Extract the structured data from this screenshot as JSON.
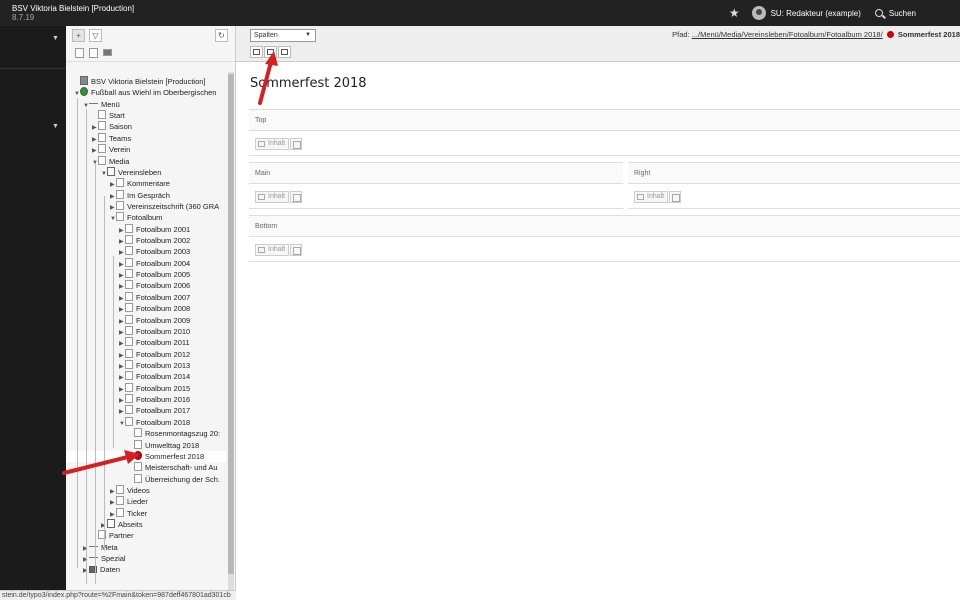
{
  "topbar": {
    "site_name": "BSV Viktoria Bielstein [Production]",
    "version": "8.7.19",
    "user_label": "SU: Redakteur (example)",
    "search_label": "Suchen"
  },
  "tree": {
    "nodes": [
      {
        "label": "BSV Viktoria Bielstein [Production]",
        "icon": "typo3-logo-icon"
      },
      {
        "label": "Fußball aus Wiehl im Oberbergischen",
        "icon": "globe-icon"
      },
      {
        "label": "Menü",
        "icon": "menu-separator-icon"
      },
      {
        "label": "Start",
        "icon": "page-icon"
      },
      {
        "label": "Saison",
        "icon": "page-icon"
      },
      {
        "label": "Teams",
        "icon": "page-icon"
      },
      {
        "label": "Verein",
        "icon": "page-icon"
      },
      {
        "label": "Media",
        "icon": "page-icon"
      },
      {
        "label": "Vereinsleben",
        "icon": "shortcut-page-icon"
      },
      {
        "label": "Kommentare",
        "icon": "page-icon"
      },
      {
        "label": "Im Gespräch",
        "icon": "page-icon"
      },
      {
        "label": "Vereinszeitschrift (360 GRA",
        "icon": "page-icon"
      },
      {
        "label": "Fotoalbum",
        "icon": "page-icon"
      },
      {
        "label": "Fotoalbum 2001",
        "icon": "page-icon"
      },
      {
        "label": "Fotoalbum 2002",
        "icon": "page-icon"
      },
      {
        "label": "Fotoalbum 2003",
        "icon": "page-icon"
      },
      {
        "label": "Fotoalbum 2004",
        "icon": "page-icon"
      },
      {
        "label": "Fotoalbum 2005",
        "icon": "page-icon"
      },
      {
        "label": "Fotoalbum 2006",
        "icon": "page-icon"
      },
      {
        "label": "Fotoalbum 2007",
        "icon": "page-icon"
      },
      {
        "label": "Fotoalbum 2008",
        "icon": "page-icon"
      },
      {
        "label": "Fotoalbum 2009",
        "icon": "page-icon"
      },
      {
        "label": "Fotoalbum 2010",
        "icon": "page-icon"
      },
      {
        "label": "Fotoalbum 2011",
        "icon": "page-icon"
      },
      {
        "label": "Fotoalbum 2012",
        "icon": "page-icon"
      },
      {
        "label": "Fotoalbum 2013",
        "icon": "page-icon"
      },
      {
        "label": "Fotoalbum 2014",
        "icon": "page-icon"
      },
      {
        "label": "Fotoalbum 2015",
        "icon": "page-icon"
      },
      {
        "label": "Fotoalbum 2016",
        "icon": "page-icon"
      },
      {
        "label": "Fotoalbum 2017",
        "icon": "page-icon"
      },
      {
        "label": "Fotoalbum 2018",
        "icon": "page-icon"
      },
      {
        "label": "Rosenmontagszug 20:",
        "icon": "page-icon"
      },
      {
        "label": "Umwelttag 2018",
        "icon": "page-icon"
      },
      {
        "label": "Sommerfest 2018",
        "icon": "restricted-page-icon"
      },
      {
        "label": "Meisterschaft- und Au",
        "icon": "page-icon"
      },
      {
        "label": "Überreichung der Sch.",
        "icon": "page-icon"
      },
      {
        "label": "Videos",
        "icon": "page-icon"
      },
      {
        "label": "Lieder",
        "icon": "page-icon"
      },
      {
        "label": "Ticker",
        "icon": "page-icon"
      },
      {
        "label": "Abseits",
        "icon": "shortcut-page-icon"
      },
      {
        "label": "Partner",
        "icon": "page-icon"
      },
      {
        "label": "Meta",
        "icon": "menu-separator-icon"
      },
      {
        "label": "Spezial",
        "icon": "menu-separator-icon"
      },
      {
        "label": "Daten",
        "icon": "folder-icon"
      }
    ]
  },
  "status_url": "stein.de/typo3/index.php?route=%2Fmain&token=987deff467801ad301cb",
  "header": {
    "view_select": "Spalten",
    "path_label": "Pfad:",
    "path_link": ".../Menü/Media/Vereinsleben/Fotoalbum/Fotoalbum 2018/",
    "path_current": "Sommerfest 2018"
  },
  "page": {
    "title": "Sommerfest 2018"
  },
  "columns": {
    "top": "Top",
    "main": "Main",
    "right": "Right",
    "bottom": "Bottom",
    "new_label": "Inhalt"
  },
  "colors": {
    "topbar": "#222222",
    "module_menu": "#1b1b1b",
    "arrow": "#d42020",
    "restricted": "#cc0000"
  }
}
